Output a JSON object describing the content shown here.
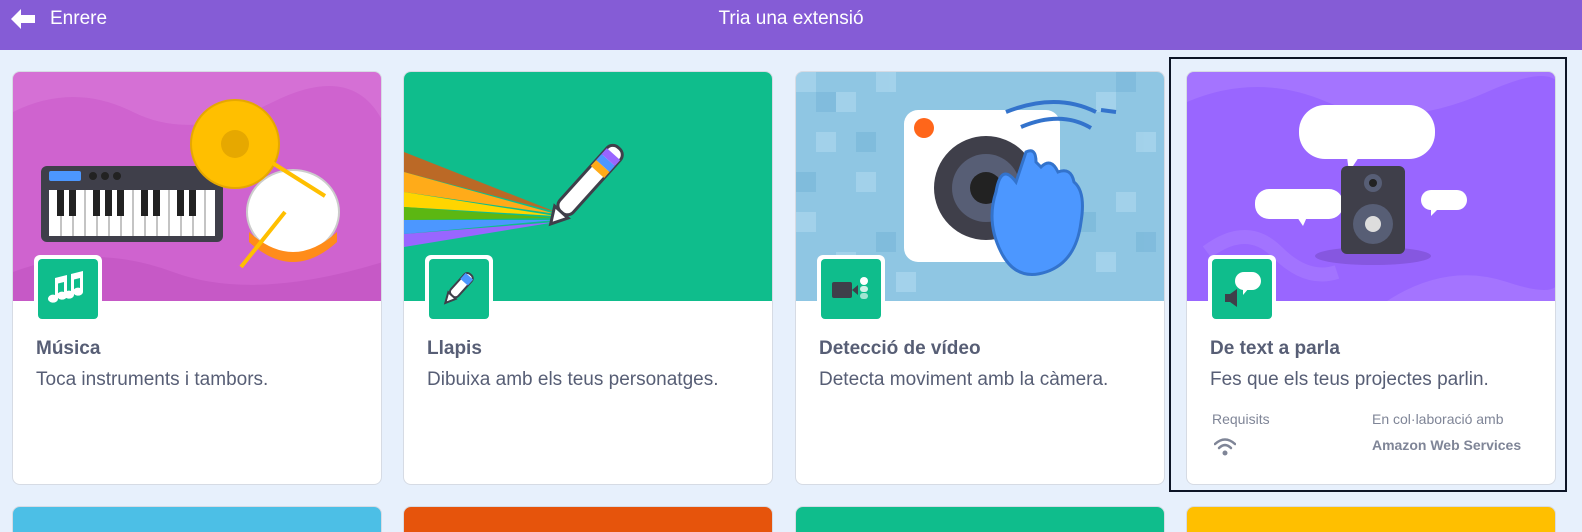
{
  "header": {
    "back_label": "Enrere",
    "title": "Tria una extensió"
  },
  "extensions": [
    {
      "name": "Música",
      "description": "Toca instruments i tambors.",
      "banner_color": "#cf63cf",
      "icon": "music-notes-icon"
    },
    {
      "name": "Llapis",
      "description": "Dibuixa amb els teus personatges.",
      "banner_color": "#0fbd8c",
      "icon": "pen-icon"
    },
    {
      "name": "Detecció de vídeo",
      "description": "Detecta moviment amb la càmera.",
      "banner_color": "#8fc6e3",
      "icon": "video-sensing-icon"
    },
    {
      "name": "De text a parla",
      "description": "Fes que els teus projectes parlin.",
      "banner_color": "#9966ff",
      "icon": "text-to-speech-icon",
      "requirements_label": "Requisits",
      "requirements_icon": "wifi-icon",
      "collaboration_label": "En col·laboració amb",
      "collaborator": "Amazon Web Services"
    }
  ],
  "next_row_colors": [
    "#4cbfe6",
    "#e6540c",
    "#0fbd8c",
    "#ffbf00"
  ]
}
